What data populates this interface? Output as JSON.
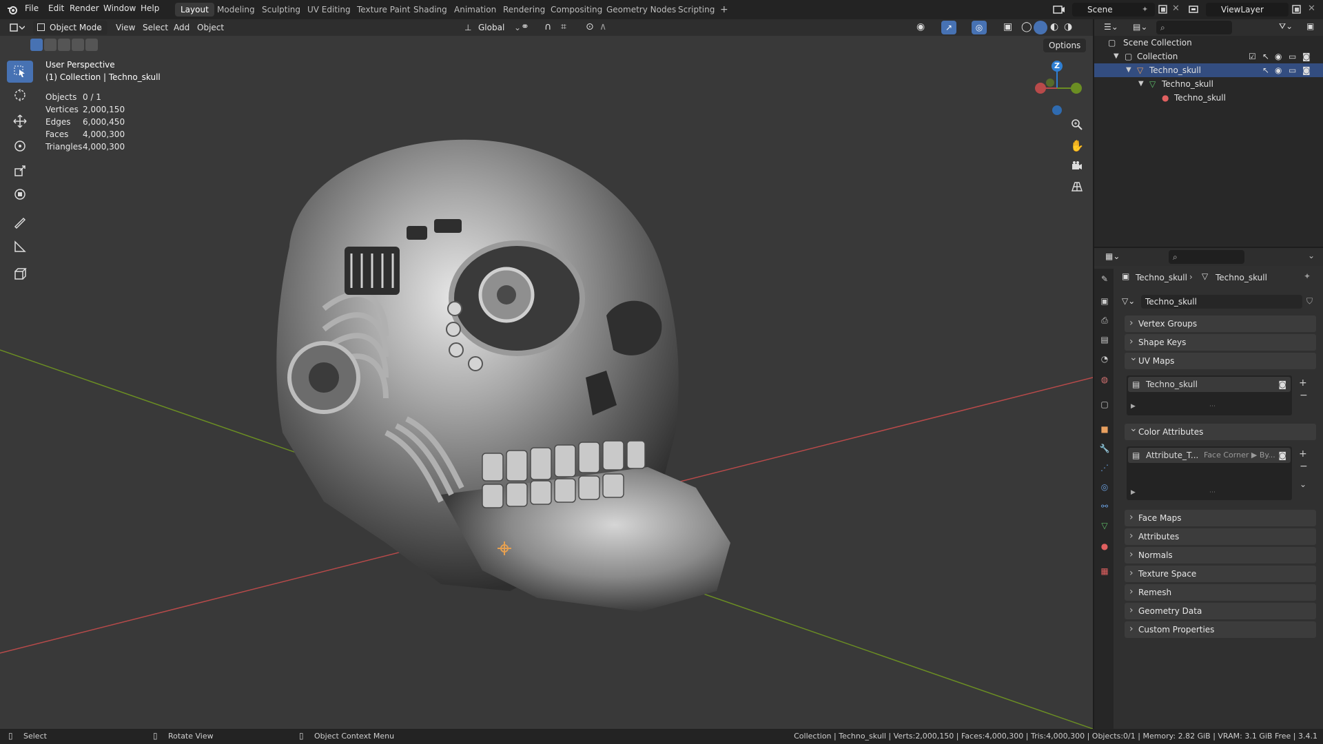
{
  "topbar": {
    "menus": [
      "File",
      "Edit",
      "Render",
      "Window",
      "Help"
    ],
    "workspaces": [
      "Layout",
      "Modeling",
      "Sculpting",
      "UV Editing",
      "Texture Paint",
      "Shading",
      "Animation",
      "Rendering",
      "Compositing",
      "Geometry Nodes",
      "Scripting"
    ],
    "add_tab": "+",
    "scene": "Scene",
    "view_layer": "ViewLayer"
  },
  "viewport_header": {
    "mode": "Object Mode",
    "menus": [
      "View",
      "Select",
      "Add",
      "Object"
    ],
    "orientation": "Global",
    "options": "Options"
  },
  "overlay": {
    "view_name": "User Perspective",
    "collection_line": "(1) Collection | Techno_skull",
    "stats": [
      {
        "label": "Objects",
        "value": "0 / 1"
      },
      {
        "label": "Vertices",
        "value": "2,000,150"
      },
      {
        "label": "Edges",
        "value": "6,000,450"
      },
      {
        "label": "Faces",
        "value": "4,000,300"
      },
      {
        "label": "Triangles",
        "value": "4,000,300"
      }
    ]
  },
  "gizmo": {
    "z_label": "Z"
  },
  "outliner": {
    "rows": [
      "Scene Collection",
      "Collection",
      "Techno_skull",
      "Techno_skull",
      "Techno_skull"
    ]
  },
  "properties": {
    "breadcrumb_object": "Techno_skull",
    "breadcrumb_data": "Techno_skull",
    "mesh_name": "Techno_skull",
    "panels": {
      "vertex_groups": "Vertex Groups",
      "shape_keys": "Shape Keys",
      "uv_maps": "UV Maps",
      "color_attributes": "Color Attributes",
      "face_maps": "Face Maps",
      "attributes": "Attributes",
      "normals": "Normals",
      "texture_space": "Texture Space",
      "remesh": "Remesh",
      "geometry_data": "Geometry Data",
      "custom_properties": "Custom Properties"
    },
    "uv_map_item": "Techno_skull",
    "color_attr_item": "Attribute_T...",
    "color_attr_domain": "Face Corner ▶ By..."
  },
  "statusbar": {
    "select": "Select",
    "rotate": "Rotate View",
    "context": "Object Context Menu",
    "info": "Collection | Techno_skull | Verts:2,000,150 | Faces:4,000,300 | Tris:4,000,300 | Objects:0/1 | Memory: 2.82 GiB | VRAM: 3.1 GiB Free | 3.4.1"
  },
  "colors": {
    "accent": "#4772b3",
    "axis_x": "#b84a4a",
    "axis_y": "#6b8e23",
    "gizmo_z": "#2f7fd3"
  }
}
